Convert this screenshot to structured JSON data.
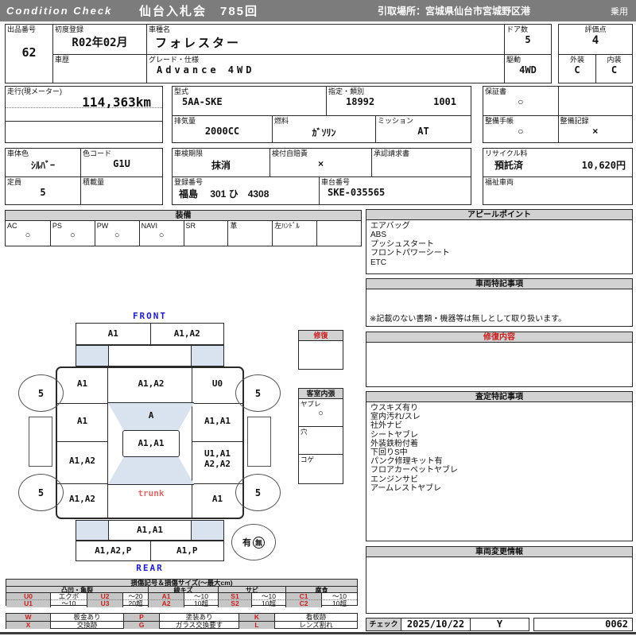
{
  "header": {
    "brand": "Condition  Check",
    "auction": "仙台入札会　785回",
    "pickup": "引取場所：宮城県仙台市宮城野区港",
    "category": "乗用"
  },
  "info": {
    "lot_label": "出品番号",
    "lot": "62",
    "first_reg_label": "初度登録",
    "first_reg": "R02年02月",
    "history_label": "車歴",
    "history": "",
    "model_name_label": "車種名",
    "model_name": "フォレスター",
    "grade_label": "グレード・仕様",
    "grade": "Advance 4WD",
    "doors_label": "ドア数",
    "doors": "5",
    "drive_label": "駆動",
    "drive": "4WD",
    "score_label": "評価点",
    "score": "4",
    "exterior_label": "外装",
    "exterior": "C",
    "interior_label": "内装",
    "interior": "C",
    "odo_label": "走行(現メーター)",
    "odo": "114,363km",
    "model_code_label": "型式",
    "model_code": "5AA-SKE",
    "type_class_label": "指定・類別",
    "type_no": "18992",
    "class_no": "1001",
    "displacement_label": "排気量",
    "displacement": "2000CC",
    "fuel_label": "燃料",
    "fuel": "ｶﾞｿﾘﾝ",
    "mission_label": "ミッション",
    "mission": "AT",
    "warranty_label": "保証書",
    "warranty": "○",
    "maintenance_book_label": "整備手帳",
    "maintenance_book": "○",
    "maintenance_record_label": "整備記録",
    "maintenance_record": "×",
    "color_label": "車体色",
    "color": "ｼﾙﾊﾞｰ",
    "color_code_label": "色コード",
    "color_code": "G1U",
    "capacity_label": "定員",
    "capacity": "5",
    "load_label": "積載量",
    "load": "",
    "inspection_label": "車検期限",
    "inspection": "抹消",
    "insurance_label": "検付自賠責",
    "insurance": "×",
    "approval_label": "承認請求書",
    "approval": "",
    "reg_no_label": "登録番号",
    "reg_no": "福島　 301 ひ　4308",
    "chassis_label": "車台番号",
    "chassis": "SKE-035565",
    "recycle_label": "リサイクル料",
    "recycle_status": "預託済",
    "recycle_fee": "10,620円",
    "welfare_label": "福祉車両",
    "welfare": ""
  },
  "equipment": {
    "title": "装備",
    "items": [
      {
        "label": "AC",
        "value": "○"
      },
      {
        "label": "PS",
        "value": "○"
      },
      {
        "label": "PW",
        "value": "○"
      },
      {
        "label": "NAVI",
        "value": "○"
      },
      {
        "label": "SR",
        "value": ""
      },
      {
        "label": "革",
        "value": ""
      },
      {
        "label": "左ﾊﾝﾄﾞﾙ",
        "value": ""
      },
      {
        "label": "",
        "value": ""
      }
    ]
  },
  "appeal": {
    "title": "アピールポイント",
    "items": [
      "エアバッグ",
      "ABS",
      "プッシュスタート",
      "フロントパワーシート",
      "ETC"
    ]
  },
  "vehicle_notes": {
    "title": "車両特記事項",
    "note": "※記載のない書類・機器等は無しとして取り扱います。"
  },
  "repair_detail": {
    "title": "修復内容"
  },
  "assessment_notes": {
    "title": "査定特記事項",
    "items": [
      "ウスキズ有り",
      "室内汚れ/スレ",
      "社外ナビ",
      "シートヤブレ",
      "外装鉄粉付着",
      "下回りS中",
      "パンク修理キット有",
      "フロアカーペットヤブレ",
      "エンジンサビ",
      "アームレストヤブレ"
    ]
  },
  "change_info": {
    "title": "車両変更情報"
  },
  "check": {
    "label": "チェック",
    "date": "2025/10/22",
    "inspector": "Y",
    "number": "0062"
  },
  "repair_box": {
    "title": "修復"
  },
  "interior_trim": {
    "title": "客室内張",
    "rows": [
      {
        "label": "ヤブレ",
        "value": "○"
      },
      {
        "label": "穴",
        "value": ""
      },
      {
        "label": "コゲ",
        "value": ""
      }
    ]
  },
  "diagram": {
    "front_label": "FRONT",
    "rear_label": "REAR",
    "trunk_label": "trunk",
    "front_bumper_left": "A1",
    "front_bumper_right": "A1,A2",
    "left_fender": "A1",
    "hood": "A1,A2",
    "right_fender": "U0",
    "left_front_door": "A1",
    "windshield": "A",
    "right_front_door": "A1,A1",
    "roof": "A1,A1",
    "left_rear_door": "A1,A2",
    "right_rear_door_line1": "U1,A1",
    "right_rear_door_line2": "A2,A2",
    "left_quarter": "A1,A2",
    "right_quarter": "A1",
    "rear_panel": "A1,A1",
    "rear_bumper_left": "A1,A2,P",
    "rear_bumper_right": "A1,P",
    "wheel_fl": "5",
    "wheel_fr": "5",
    "wheel_rl": "5",
    "wheel_rr": "5",
    "repair_yes": "有",
    "repair_no": "無"
  },
  "legend": {
    "title": "損傷記号＆損傷サイズ(〜最大cm)",
    "groups": [
      "凸凹・亀裂",
      "線キズ",
      "サビ",
      "腐食"
    ],
    "row1": [
      "U0",
      "エクボ",
      "U2",
      "〜20",
      "A1",
      "〜10",
      "S1",
      "〜10",
      "C1",
      "〜10"
    ],
    "row2": [
      "U1",
      "〜10",
      "U3",
      "20超",
      "A2",
      "10超",
      "S2",
      "10超",
      "C2",
      "10超"
    ],
    "codes": [
      [
        "W",
        "板金あり",
        "P",
        "塗装あり",
        "K",
        "看板跡"
      ],
      [
        "X",
        "交換跡",
        "G",
        "ガラス交換要す",
        "L",
        "レンズ割れ"
      ]
    ]
  }
}
